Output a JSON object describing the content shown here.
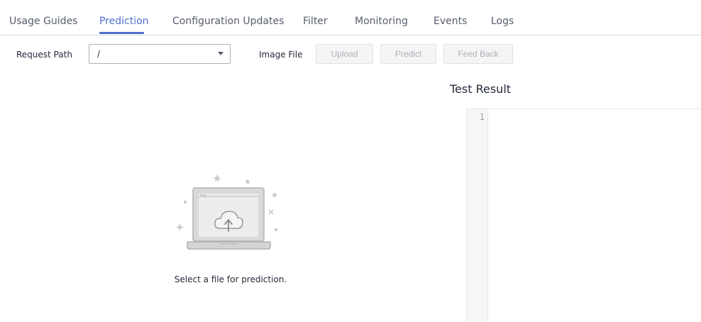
{
  "tabs": [
    {
      "label": "Usage Guides",
      "active": false
    },
    {
      "label": "Prediction",
      "active": true
    },
    {
      "label": "Configuration Updates",
      "active": false
    },
    {
      "label": "Filter",
      "active": false
    },
    {
      "label": "Monitoring",
      "active": false
    },
    {
      "label": "Events",
      "active": false
    },
    {
      "label": "Logs",
      "active": false
    }
  ],
  "form": {
    "request_path_label": "Request Path",
    "request_path_value": "/",
    "image_file_label": "Image File",
    "upload_label": "Upload",
    "predict_label": "Predict",
    "feedback_label": "Feed Back"
  },
  "result": {
    "title": "Test Result",
    "line_number": "1"
  },
  "empty_state": {
    "caption": "Select a file for prediction."
  },
  "colors": {
    "accent": "#526ecc",
    "disabled_text": "#adb0b8"
  },
  "icons": {
    "upload_illustration": "laptop-cloud-upload-icon",
    "dropdown": "chevron-down-icon"
  }
}
